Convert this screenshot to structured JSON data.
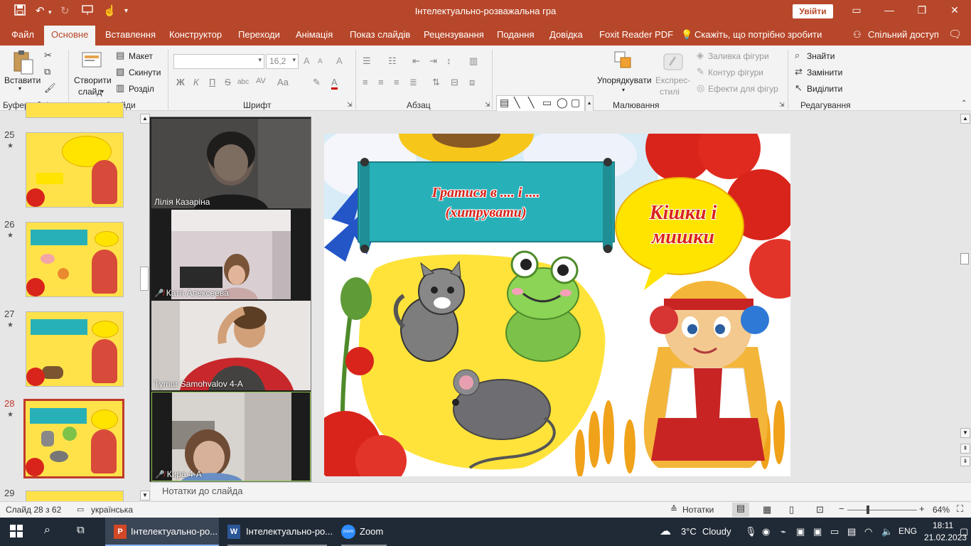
{
  "app": {
    "doc_title": "Інтелектуально-розважальна гра",
    "signin_label": "Увійти",
    "accent": "#b7472a"
  },
  "quick_access": {
    "save_icon": "save-icon",
    "undo_icon": "undo-icon",
    "redo_icon": "redo-icon",
    "present_icon": "present-icon",
    "touch_icon": "touch-mode-icon",
    "more_icon": "customize-icon"
  },
  "window_controls": {
    "ribbon_display": "▭",
    "minimize": "—",
    "restore": "❐",
    "close": "✕"
  },
  "tabs": [
    {
      "label": "Файл"
    },
    {
      "label": "Основне"
    },
    {
      "label": "Вставлення"
    },
    {
      "label": "Конструктор"
    },
    {
      "label": "Переходи"
    },
    {
      "label": "Анімація"
    },
    {
      "label": "Показ слайдів"
    },
    {
      "label": "Рецензування"
    },
    {
      "label": "Подання"
    },
    {
      "label": "Довідка"
    },
    {
      "label": "Foxit Reader PDF"
    }
  ],
  "tell_me": "Скажіть, що потрібно зробити",
  "share": "Спільний доступ",
  "ribbon": {
    "clipboard": {
      "paste": "Вставити",
      "label": "Буфер обміну"
    },
    "slides": {
      "new_slide": "Створити",
      "new_slide2": "слайд",
      "layout": "Макет",
      "reset": "Скинути",
      "section": "Розділ",
      "label": "Слайди"
    },
    "font": {
      "font_name": "",
      "font_size": "16,2",
      "label": "Шрифт",
      "bold": "Ж",
      "italic": "К",
      "underline": "П",
      "strike": "S",
      "shadow": "abc",
      "spacing": "AV",
      "case": "Aa",
      "color": "A",
      "grow": "A",
      "shrink": "A",
      "clear": "A"
    },
    "paragraph": {
      "label": "Абзац"
    },
    "drawing": {
      "arrange": "Упорядкувати",
      "quick_styles": "Експрес-",
      "quick_styles2": "стилі",
      "fill": "Заливка фігури",
      "outline": "Контур фігури",
      "effects": "Ефекти для фігур",
      "label": "Малювання"
    },
    "editing": {
      "find": "Знайти",
      "replace": "Замінити",
      "select": "Виділити",
      "label": "Редагування"
    }
  },
  "slides": [
    {
      "num": "25",
      "star": "★"
    },
    {
      "num": "26",
      "star": "★"
    },
    {
      "num": "27",
      "star": "★"
    },
    {
      "num": "28",
      "star": "★"
    },
    {
      "num": "29",
      "star": ""
    }
  ],
  "slide": {
    "banner_line1": "Гратися в .... і ....",
    "banner_line2": "(хитрувати)",
    "bubble_line1": "Кішки і",
    "bubble_line2": "мишки"
  },
  "participants": [
    {
      "name": "Лілія Казаріна",
      "muted": false
    },
    {
      "name": "Катя Алексеева",
      "muted": true
    },
    {
      "name": "Tymur Samohvalov 4-A",
      "muted": false
    },
    {
      "name": "Кира 4-А",
      "muted": true
    }
  ],
  "notes_label": "Нотатки до слайда",
  "status": {
    "slide_of": "Слайд 28 з 62",
    "language": "українська",
    "notes": "Нотатки",
    "zoom": "64%",
    "zoom_fraction": 0.64
  },
  "taskbar": {
    "apps": [
      {
        "label": "Інтелектуально-ро...",
        "icon": "powerpoint-icon"
      },
      {
        "label": "Інтелектуально-ро...",
        "icon": "word-icon"
      },
      {
        "label": "Zoom",
        "icon": "zoom-icon"
      }
    ],
    "weather": "3°C",
    "weather_text": "Cloudy",
    "lang": "ENG",
    "time": "18:11",
    "date": "21.02.2023"
  }
}
